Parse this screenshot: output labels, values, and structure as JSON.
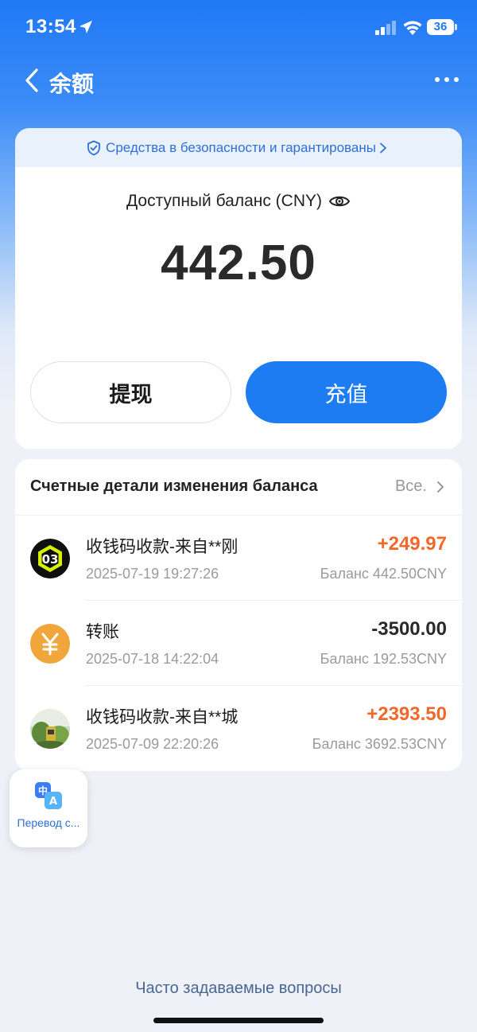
{
  "status_bar": {
    "time": "13:54",
    "battery": "36",
    "icons": [
      "location-arrow-icon",
      "signal-icon",
      "wifi-icon",
      "battery-icon"
    ]
  },
  "nav": {
    "title": "余额",
    "back_icon": "chevron-left-icon",
    "more_icon": "more-dots-icon"
  },
  "balance_card": {
    "security_text": "Средства в безопасности и гарантированы",
    "label": "Доступный баланс (CNY)",
    "amount": "442.50",
    "withdraw_label": "提现",
    "topup_label": "充值"
  },
  "transactions": {
    "header_title": "Счетные детали изменения баланса",
    "header_all": "Все.",
    "items": [
      {
        "title": "收钱码收款-来自**刚",
        "date": "2025-07-19 19:27:26",
        "amount": "+249.97",
        "balance": "Баланс 442.50CNY",
        "avatar": "number-03-avatar"
      },
      {
        "title": "转账",
        "date": "2025-07-18 14:22:04",
        "amount": "-3500.00",
        "balance": "Баланс 192.53CNY",
        "avatar": "yuan-icon"
      },
      {
        "title": "收钱码收款-来自**城",
        "date": "2025-07-09 22:20:26",
        "amount": "+2393.50",
        "balance": "Баланс 3692.53CNY",
        "avatar": "photo-avatar"
      }
    ]
  },
  "translate_widget": {
    "label": "Перевод с..."
  },
  "faq": "Часто задаваемые вопросы",
  "colors": {
    "primary": "#1e7cf2",
    "positive_amount": "#f0692b",
    "yuan_icon": "#f0a63a",
    "background": "#eef2f8"
  }
}
